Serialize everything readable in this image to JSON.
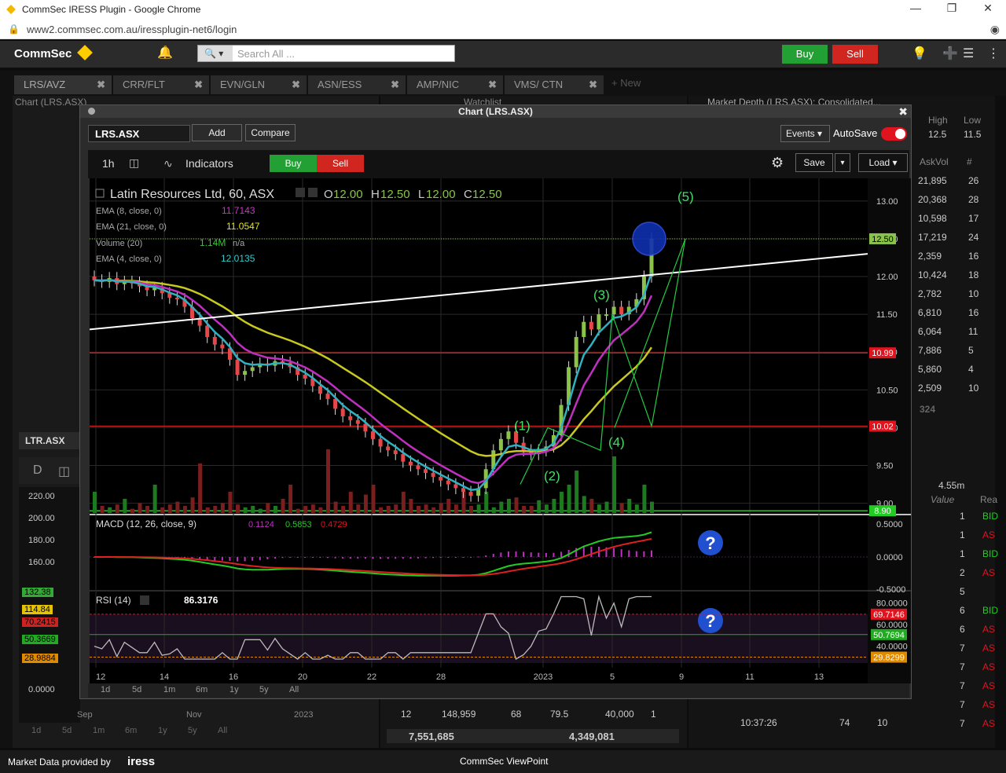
{
  "browser": {
    "title": "CommSec IRESS Plugin - Google Chrome",
    "url": "www2.commsec.com.au/iressplugin-net6/login"
  },
  "header": {
    "logo": "CommSec",
    "search_placeholder": "Search All ...",
    "buy_label": "Buy",
    "sell_label": "Sell"
  },
  "tabs": [
    {
      "label": "LRS/AVZ"
    },
    {
      "label": "CRR/FLT"
    },
    {
      "label": "EVN/GLN"
    },
    {
      "label": "ASN/ESS"
    },
    {
      "label": "AMP/NIC"
    },
    {
      "label": "VMS/ CTN"
    }
  ],
  "tab_new": "+ New",
  "background": {
    "chart_panel_title": "Chart (LRS.ASX)",
    "watchlist_title": "Watchlist",
    "depth_title": "Market Depth (LRS.ASX): Consolidated...",
    "depth_high_label": "High",
    "depth_low_label": "Low",
    "depth_high": "12.5",
    "depth_low": "11.5",
    "depth_col_askvol": "AskVol",
    "depth_col_hash": "#",
    "depth_rows": [
      {
        "vol": "21,895",
        "n": "26"
      },
      {
        "vol": "20,368",
        "n": "28"
      },
      {
        "vol": "10,598",
        "n": "17"
      },
      {
        "vol": "17,219",
        "n": "24"
      },
      {
        "vol": "2,359",
        "n": "16"
      },
      {
        "vol": "10,424",
        "n": "18"
      },
      {
        "vol": "2,782",
        "n": "10"
      },
      {
        "vol": "6,810",
        "n": "16"
      },
      {
        "vol": "6,064",
        "n": "11"
      },
      {
        "vol": "7,886",
        "n": "5"
      },
      {
        "vol": "5,860",
        "n": "4"
      },
      {
        "vol": "2,509",
        "n": "10"
      }
    ],
    "depth_total": "324",
    "course_vol": "4.55m",
    "course_col_value": "Value",
    "course_col_rea": "Rea",
    "course_rows": [
      {
        "v": "1",
        "s": "BID"
      },
      {
        "v": "1",
        "s": "AS"
      },
      {
        "v": "1",
        "s": "BID"
      },
      {
        "v": "2",
        "s": "AS"
      },
      {
        "v": "5",
        "s": ""
      },
      {
        "v": "6",
        "s": "BID"
      },
      {
        "v": "6",
        "s": "AS"
      },
      {
        "v": "7",
        "s": "AS"
      },
      {
        "v": "7",
        "s": "AS"
      },
      {
        "v": "7",
        "s": "AS"
      },
      {
        "v": "7",
        "s": "AS"
      },
      {
        "v": "7",
        "s": "AS"
      }
    ],
    "course_time": "10:37:26",
    "course_time_a": "74",
    "course_time_b": "10",
    "ltr_symbol": "LTR.ASX",
    "ltr_yticks": [
      "220.00",
      "200.00",
      "180.00",
      "160.00"
    ],
    "ltr_tags": [
      "132.38",
      "114.84",
      "70.2415",
      "50.3669",
      "28.9884"
    ],
    "ltr_zero": "0.0000",
    "ltr_xticks": [
      "Sep",
      "Nov",
      "2023"
    ],
    "ltr_ranges": [
      "1d",
      "5d",
      "1m",
      "6m",
      "1y",
      "5y",
      "All"
    ],
    "trades_row": [
      "12",
      "148,959",
      "68",
      "79.5",
      "40,000",
      "1"
    ],
    "trades_totals": [
      "7,551,685",
      "4,349,081"
    ]
  },
  "modal": {
    "title": "Chart (LRS.ASX)",
    "symbol": "LRS.ASX",
    "add_label": "Add",
    "compare_label": "Compare",
    "events_label": "Events",
    "autosave_label": "AutoSave",
    "interval": "1h",
    "indicators_label": "Indicators",
    "buy_label": "Buy",
    "sell_label": "Sell",
    "save_label": "Save",
    "load_label": "Load",
    "ranges": [
      "1d",
      "5d",
      "1m",
      "6m",
      "1y",
      "5y",
      "All"
    ]
  },
  "chart_data": {
    "type": "candlestick",
    "instrument": "Latin Resources Ltd, 60, ASX",
    "ohlc": {
      "O": "12.00",
      "H": "12.50",
      "L": "12.00",
      "C": "12.50"
    },
    "price_axis": {
      "range": [
        8.85,
        13.3
      ],
      "ticks": [
        "13.00",
        "12.50",
        "12.00",
        "11.50",
        "11.00",
        "10.50",
        "10.00",
        "9.50",
        "9.00"
      ]
    },
    "price_tags": [
      {
        "value": "12.50",
        "color": "#8bc34a"
      },
      {
        "value": "10.99",
        "color": "#e0141e"
      },
      {
        "value": "10.02",
        "color": "#e0141e"
      },
      {
        "value": "8.90",
        "color": "#22cc22"
      }
    ],
    "horizontal_lines": [
      10.99,
      10.02,
      8.9
    ],
    "x_ticks": [
      "12",
      "14",
      "16",
      "20",
      "22",
      "28",
      "2023",
      "5",
      "9",
      "11",
      "13"
    ],
    "indicators": [
      {
        "name": "EMA (8, close, 0)",
        "value": "11.7143",
        "color": "#cc33cc"
      },
      {
        "name": "EMA (21, close, 0)",
        "value": "11.0547",
        "color": "#e6e600"
      },
      {
        "name": "Volume (20)",
        "value": "1.14M",
        "extra": "n/a",
        "color": "#33cc33"
      },
      {
        "name": "EMA (4, close, 0)",
        "value": "12.0135",
        "color": "#33cccc"
      }
    ],
    "close": [
      11.95,
      11.93,
      11.98,
      11.9,
      11.93,
      11.92,
      11.87,
      11.82,
      11.85,
      11.78,
      11.72,
      11.7,
      11.6,
      11.45,
      11.35,
      11.2,
      11.1,
      11.05,
      10.9,
      10.7,
      10.75,
      10.8,
      10.85,
      10.82,
      10.88,
      10.86,
      10.8,
      10.7,
      10.65,
      10.55,
      10.45,
      10.38,
      10.25,
      10.15,
      10.1,
      10.05,
      9.95,
      9.85,
      9.75,
      9.7,
      9.65,
      9.55,
      9.5,
      9.45,
      9.4,
      9.35,
      9.3,
      9.25,
      9.2,
      9.15,
      9.1,
      9.2,
      9.45,
      9.7,
      9.85,
      9.95,
      9.8,
      9.7,
      9.65,
      9.7,
      9.75,
      9.9,
      10.3,
      10.8,
      11.2,
      11.4,
      11.3,
      11.5,
      11.5,
      11.6,
      11.5,
      11.6,
      11.7,
      12.0,
      12.5
    ],
    "wave_labels": [
      "(1)",
      "(2)",
      "(3)",
      "(4)",
      "(5)"
    ],
    "macd": {
      "label": "MACD (12, 26, close, 9)",
      "values": [
        "0.1124",
        "0.5853",
        "0.4729"
      ],
      "axis": [
        "0.5000",
        "0.0000",
        "-0.5000"
      ]
    },
    "rsi": {
      "label": "RSI (14)",
      "value": "86.3176",
      "axis": [
        "80.0000",
        "60.0000",
        "40.0000"
      ],
      "tags": [
        {
          "value": "69.7146",
          "color": "#e0141e"
        },
        {
          "value": "50.7694",
          "color": "#22aa22"
        },
        {
          "value": "29.8299",
          "color": "#e08a00"
        }
      ]
    }
  },
  "footer": {
    "provider": "Market Data provided by",
    "brand": "iress",
    "app": "CommSec ViewPoint"
  }
}
